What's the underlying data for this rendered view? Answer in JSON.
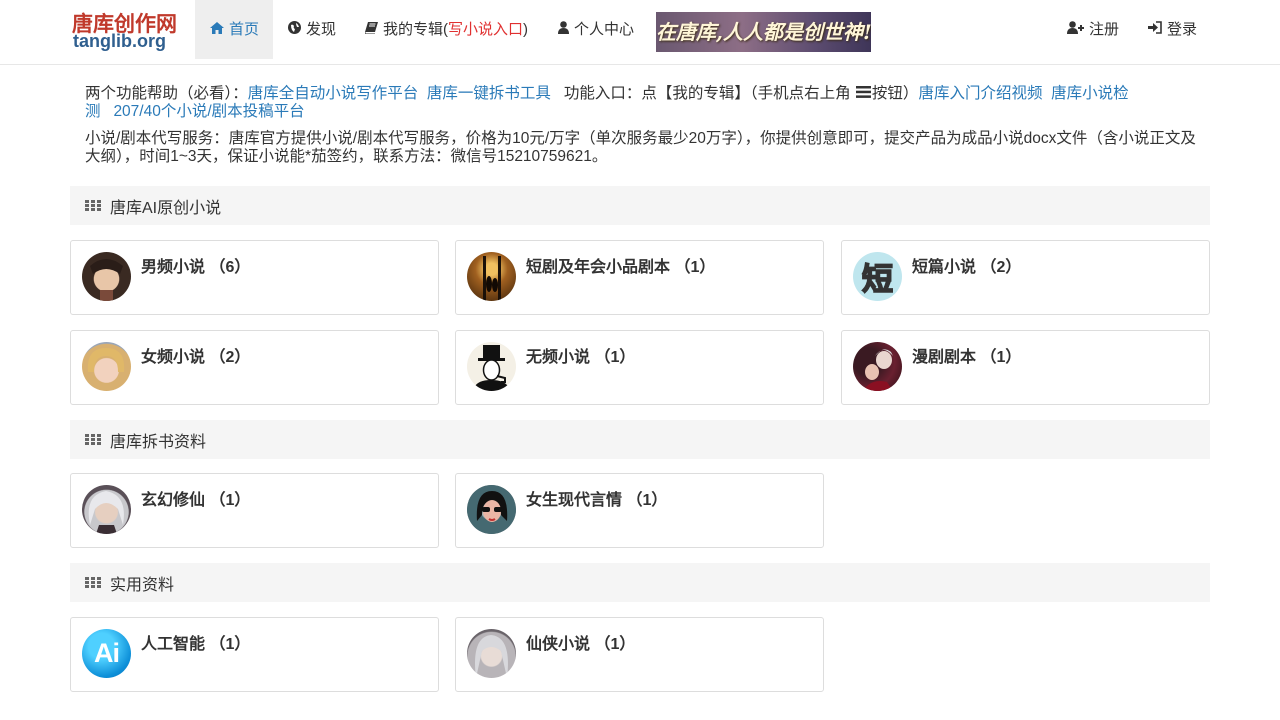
{
  "brand": {
    "logo_cn": "唐库创作网",
    "logo_en": "tanglib.org"
  },
  "nav": {
    "home": "首页",
    "discover": "发现",
    "albums_prefix": "我的专辑(",
    "albums_link": "写小说入口",
    "albums_suffix": ")",
    "personal": "个人中心",
    "banner_text": "在唐库,人人都是创世神!",
    "register": "注册",
    "login": "登录"
  },
  "info": {
    "help_prefix": "两个功能帮助（必看）：",
    "link_platform": "唐库全自动小说写作平台",
    "link_split": "唐库一键拆书工具",
    "entry_text": "功能入口：点【我的专辑】（手机点右上角",
    "entry_suffix": "按钮）",
    "link_video": "唐库入门介绍视频",
    "link_detect": "唐库小说检测",
    "link_submit": "207/40个小说/剧本投稿平台",
    "service_text": "小说/剧本代写服务：唐库官方提供小说/剧本代写服务，价格为10元/万字（单次服务最少20万字），你提供创意即可，提交产品为成品小说docx文件（含小说正文及大纲），时间1~3天，保证小说能*茄签约，联系方法：微信号15210759621。"
  },
  "sections": [
    {
      "title": "唐库AI原创小说",
      "items": [
        {
          "label": "男频小说 （6）",
          "icon": "male-portrait"
        },
        {
          "label": "短剧及年会小品剧本 （1）",
          "icon": "stage-scene"
        },
        {
          "label": "短篇小说 （2）",
          "icon": "duan-char"
        },
        {
          "label": "女频小说 （2）",
          "icon": "female-portrait"
        },
        {
          "label": "无频小说 （1）",
          "icon": "top-hat-man"
        },
        {
          "label": "漫剧剧本 （1）",
          "icon": "couple-portrait"
        }
      ]
    },
    {
      "title": "唐库拆书资料",
      "items": [
        {
          "label": "玄幻修仙 （1）",
          "icon": "cultivator-portrait"
        },
        {
          "label": "女生现代言情 （1）",
          "icon": "sunglasses-woman"
        }
      ]
    },
    {
      "title": "实用资料",
      "items": [
        {
          "label": "人工智能 （1）",
          "icon": "ai-logo"
        },
        {
          "label": "仙侠小说 （1）",
          "icon": "xianxia-portrait"
        }
      ]
    }
  ],
  "colors": {
    "link": "#2a7ab8",
    "accent_red": "#e03030",
    "section_bg": "#f5f5f5"
  }
}
